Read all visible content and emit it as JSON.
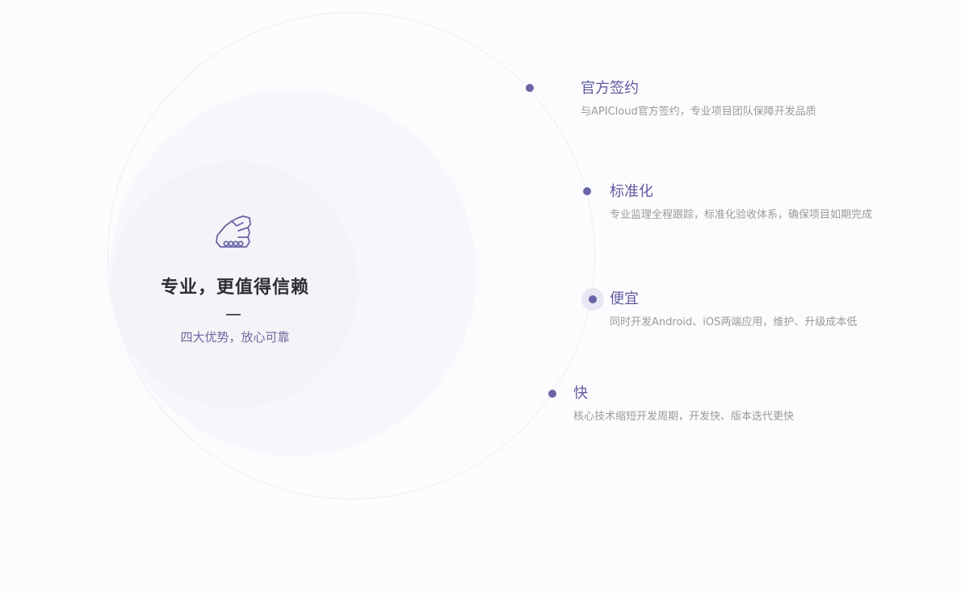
{
  "center": {
    "title": "专业，更值得信赖",
    "subtitle": "四大优势，放心可靠",
    "icon": "handshake-icon"
  },
  "features": [
    {
      "title": "官方签约",
      "desc": "与APICloud官方签约，专业项目团队保障开发品质"
    },
    {
      "title": "标准化",
      "desc": "专业监理全程跟踪，标准化验收体系，确保项目如期完成"
    },
    {
      "title": "便宜",
      "desc": "同时开发Android、iOS两端应用，维护、升级成本低"
    },
    {
      "title": "快",
      "desc": "核心技术缩短开发周期，开发快、版本迭代更快"
    }
  ],
  "colors": {
    "accent": "#6a64a8",
    "title_text": "#2d2d33",
    "desc_text": "#9a9a9a"
  }
}
